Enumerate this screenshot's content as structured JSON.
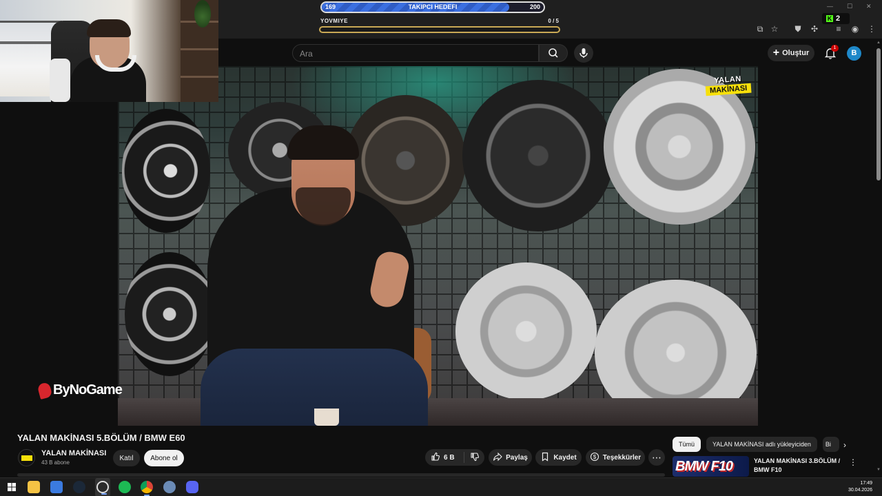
{
  "overlay": {
    "follower_goal": {
      "label": "TAKIPCI HEDEFI",
      "current": "169",
      "target": "200",
      "progress": 0.845
    },
    "daily": {
      "label": "YOVMIYE",
      "count": "0 / 5",
      "progress": 0
    },
    "kick_viewers": "2"
  },
  "masthead": {
    "search_placeholder": "Ara",
    "create_label": "Oluştur",
    "notification_count": "1",
    "avatar_letter": "B"
  },
  "video": {
    "watermark_line1": "YALAN",
    "watermark_line2": "MAKİNASI",
    "sponsor": "ByNoGame"
  },
  "watch": {
    "title": "YALAN MAKİNASI 5.BÖLÜM / BMW E60",
    "channel_name": "YALAN MAKİNASI",
    "subscribers": "43 B abone",
    "join_label": "Katıl",
    "subscribe_label": "Abone ol",
    "likes": "6 B",
    "share_label": "Paylaş",
    "save_label": "Kaydet",
    "thanks_label": "Teşekkürler"
  },
  "related": {
    "chips": [
      "Tümü",
      "YALAN MAKİNASI adlı yükleyiciden",
      "Bi"
    ],
    "items": [
      {
        "thumb_text": "BMW F10",
        "title": "YALAN MAKİNASI 3.BÖLÜM / BMW F10"
      }
    ]
  },
  "taskbar": {
    "time": "17:49",
    "date": "30.04.2026"
  },
  "colors": {
    "yt_bg": "#0f0f0f",
    "accent_red": "#cc0000",
    "goal_blue": "#3b6fe0",
    "kick_green": "#53fc18",
    "watermark_yellow": "#f7e00a"
  }
}
